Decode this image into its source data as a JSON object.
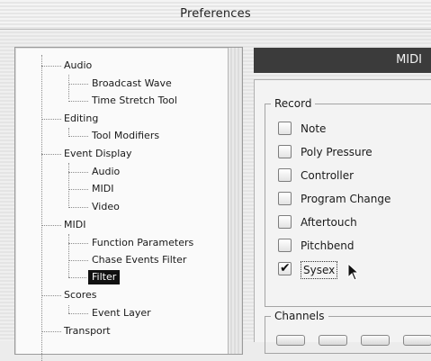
{
  "window": {
    "title": "Preferences"
  },
  "tree": {
    "items": [
      {
        "label": "Audio",
        "level": 0
      },
      {
        "label": "Broadcast Wave",
        "level": 1
      },
      {
        "label": "Time Stretch Tool",
        "level": 1
      },
      {
        "label": "Editing",
        "level": 0
      },
      {
        "label": "Tool Modifiers",
        "level": 1
      },
      {
        "label": "Event Display",
        "level": 0
      },
      {
        "label": "Audio",
        "level": 1
      },
      {
        "label": "MIDI",
        "level": 1
      },
      {
        "label": "Video",
        "level": 1
      },
      {
        "label": "MIDI",
        "level": 0
      },
      {
        "label": "Function Parameters",
        "level": 1
      },
      {
        "label": "Chase Events Filter",
        "level": 1
      },
      {
        "label": "Filter",
        "level": 1,
        "selected": true
      },
      {
        "label": "Scores",
        "level": 0
      },
      {
        "label": "Event Layer",
        "level": 1
      },
      {
        "label": "Transport",
        "level": 0
      }
    ]
  },
  "panel": {
    "header": "MIDI",
    "record_group": {
      "title": "Record",
      "options": [
        {
          "label": "Note",
          "checked": false
        },
        {
          "label": "Poly Pressure",
          "checked": false
        },
        {
          "label": "Controller",
          "checked": false
        },
        {
          "label": "Program Change",
          "checked": false
        },
        {
          "label": "Aftertouch",
          "checked": false
        },
        {
          "label": "Pitchbend",
          "checked": false
        },
        {
          "label": "Sysex",
          "checked": true
        }
      ]
    },
    "channels_group": {
      "title": "Channels"
    }
  }
}
